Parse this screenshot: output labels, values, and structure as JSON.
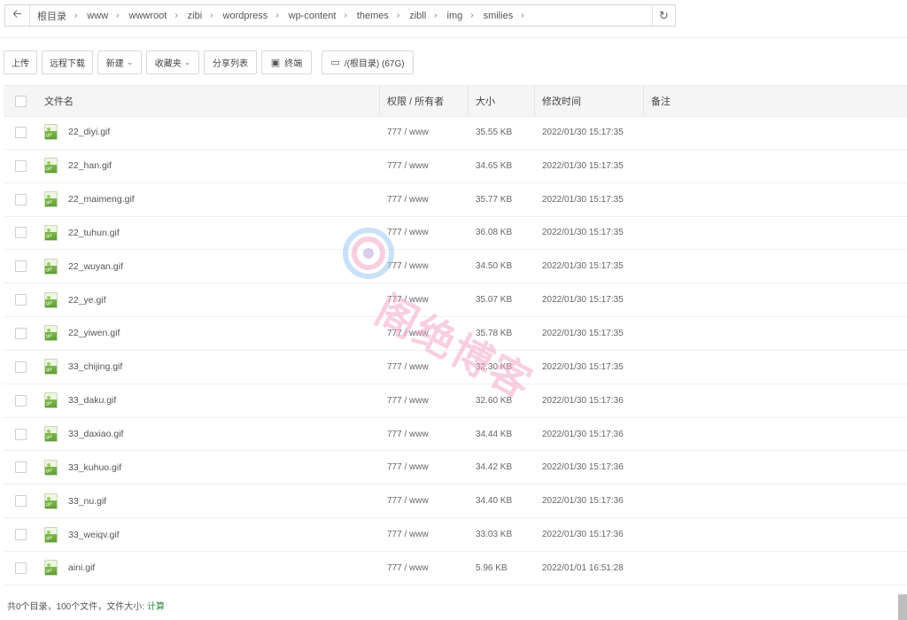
{
  "path": {
    "crumbs": [
      "根目录",
      "www",
      "wwwroot",
      "zibi",
      "wordpress",
      "wp-content",
      "themes",
      "zibll",
      "img",
      "smilies"
    ]
  },
  "toolbar": {
    "upload": "上传",
    "remote_download": "远程下载",
    "new": "新建",
    "favorites": "收藏夹",
    "share_list": "分享列表",
    "terminal": "终端",
    "disk": "/(根目录) (67G)"
  },
  "table": {
    "headers": {
      "name": "文件名",
      "perm": "权限 / 所有者",
      "size": "大小",
      "mtime": "修改时间",
      "note": "备注"
    },
    "rows": [
      {
        "name": "22_diyi.gif",
        "perm": "777 / www",
        "size": "35.55 KB",
        "mtime": "2022/01/30 15:17:35"
      },
      {
        "name": "22_han.gif",
        "perm": "777 / www",
        "size": "34.65 KB",
        "mtime": "2022/01/30 15:17:35"
      },
      {
        "name": "22_maimeng.gif",
        "perm": "777 / www",
        "size": "35.77 KB",
        "mtime": "2022/01/30 15:17:35"
      },
      {
        "name": "22_tuhun.gif",
        "perm": "777 / www",
        "size": "36.08 KB",
        "mtime": "2022/01/30 15:17:35"
      },
      {
        "name": "22_wuyan.gif",
        "perm": "777 / www",
        "size": "34.50 KB",
        "mtime": "2022/01/30 15:17:35"
      },
      {
        "name": "22_ye.gif",
        "perm": "777 / www",
        "size": "35.07 KB",
        "mtime": "2022/01/30 15:17:35"
      },
      {
        "name": "22_yiwen.gif",
        "perm": "777 / www",
        "size": "35.78 KB",
        "mtime": "2022/01/30 15:17:35"
      },
      {
        "name": "33_chijing.gif",
        "perm": "777 / www",
        "size": "32.30 KB",
        "mtime": "2022/01/30 15:17:35"
      },
      {
        "name": "33_daku.gif",
        "perm": "777 / www",
        "size": "32.60 KB",
        "mtime": "2022/01/30 15:17:36"
      },
      {
        "name": "33_daxiao.gif",
        "perm": "777 / www",
        "size": "34.44 KB",
        "mtime": "2022/01/30 15:17:36"
      },
      {
        "name": "33_kuhuo.gif",
        "perm": "777 / www",
        "size": "34.42 KB",
        "mtime": "2022/01/30 15:17:36"
      },
      {
        "name": "33_nu.gif",
        "perm": "777 / www",
        "size": "34.40 KB",
        "mtime": "2022/01/30 15:17:36"
      },
      {
        "name": "33_weiqv.gif",
        "perm": "777 / www",
        "size": "33.03 KB",
        "mtime": "2022/01/30 15:17:36"
      },
      {
        "name": "aini.gif",
        "perm": "777 / www",
        "size": "5.96 KB",
        "mtime": "2022/01/01 16:51:28"
      }
    ]
  },
  "footer": {
    "summary": "共0个目录，100个文件，文件大小:",
    "calc_link": "计算"
  },
  "watermark": {
    "text": "阁绝博客"
  },
  "icons": {
    "back": "arrow-left-icon",
    "refresh": "refresh-icon",
    "terminal": "terminal-icon",
    "disk": "disk-icon",
    "file": "gif-file-icon"
  },
  "colors": {
    "link": "#2f8a3f",
    "watermark": "#f3a9c8",
    "file_icon": "#6aab3d"
  }
}
